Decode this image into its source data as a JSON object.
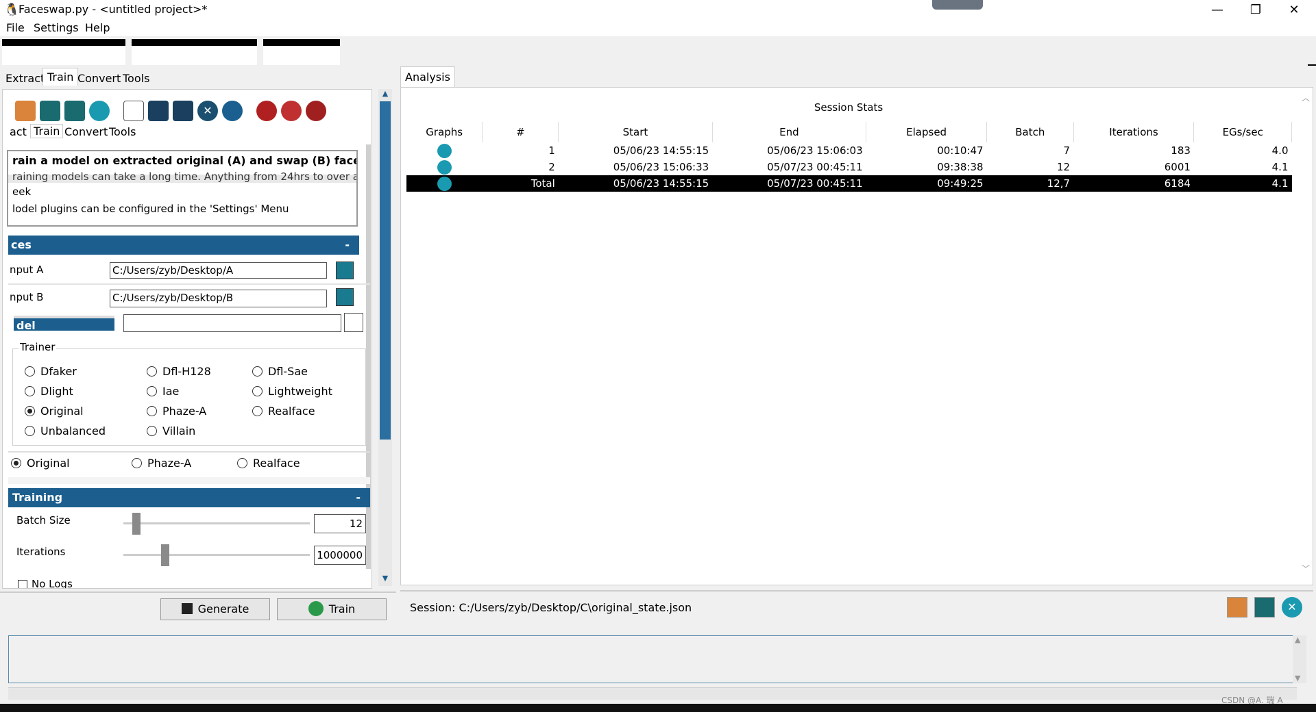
{
  "window": {
    "title": "Faceswap.py - <untitled project>*",
    "minimize": "—",
    "restore": "❐",
    "close": "✕"
  },
  "menu": {
    "items": [
      "File",
      "Settings",
      "Help"
    ]
  },
  "left_tabs": [
    "Extract",
    "Train",
    "Convert",
    "Tools"
  ],
  "left_subtabs": [
    "act",
    "Train",
    "Convert",
    "Tools"
  ],
  "toolbar_icons": [
    "open-folder-icon",
    "save-icon",
    "save-as-icon",
    "reload-icon",
    "new-file-icon",
    "save-icon",
    "save-as-icon",
    "cancel-icon",
    "reload-icon",
    "model-icon",
    "list-icon",
    "clear-icon"
  ],
  "info": {
    "heading": "rain a model on extracted original (A) and swap (B) faces.",
    "line1": "raining models can take a long time. Anything from 24hrs to over a",
    "line2": "eek",
    "line3": "lodel plugins can be configured in the 'Settings' Menu"
  },
  "faces_section": {
    "title": "ces",
    "collapse": "-",
    "input_a_label": "nput A",
    "input_a_value": "C:/Users/zyb/Desktop/A",
    "input_b_label": "nput B",
    "input_b_value": "C:/Users/zyb/Desktop/B"
  },
  "model_section": {
    "label": "del",
    "value": ""
  },
  "trainer": {
    "title": "Trainer",
    "options": [
      [
        "Dfaker",
        "Dfl-H128",
        "Dfl-Sae"
      ],
      [
        "Dlight",
        "Iae",
        "Lightweight"
      ],
      [
        "Original",
        "Phaze-A",
        "Realface"
      ],
      [
        "Unbalanced",
        "Villain",
        ""
      ]
    ],
    "selected": "Original",
    "ghost_row": [
      "Original",
      "Phaze-A",
      "Realface"
    ]
  },
  "training_section": {
    "title": "Training",
    "collapse": "-",
    "batch_label": "Batch Size",
    "batch_value": "12",
    "batch_fraction": 0.05,
    "iter_label": "Iterations",
    "iter_value": "1000000",
    "iter_fraction": 0.21,
    "no_logs": "No Logs"
  },
  "bottom_buttons": {
    "generate": "Generate",
    "train": "Train"
  },
  "right": {
    "tab": "Analysis",
    "session_title": "Session Stats",
    "columns": [
      "Graphs",
      "#",
      "Start",
      "End",
      "Elapsed",
      "Batch",
      "Iterations",
      "EGs/sec"
    ],
    "rows": [
      {
        "num": "1",
        "start": "05/06/23 14:55:15",
        "end": "05/06/23 15:06:03",
        "elapsed": "00:10:47",
        "batch": "7",
        "iterations": "183",
        "egs": "4.0"
      },
      {
        "num": "2",
        "start": "05/06/23 15:06:33",
        "end": "05/07/23 00:45:11",
        "elapsed": "09:38:38",
        "batch": "12",
        "iterations": "6001",
        "egs": "4.1"
      },
      {
        "num": "Total",
        "start": "05/06/23 14:55:15",
        "end": "05/07/23 00:45:11",
        "elapsed": "09:49:25",
        "batch": "12,7",
        "iterations": "6184",
        "egs": "4.1"
      }
    ],
    "session_path": "Session: C:/Users/zyb/Desktop/C\\original_state.json"
  },
  "watermark": "CSDN @A. 瑞 A"
}
